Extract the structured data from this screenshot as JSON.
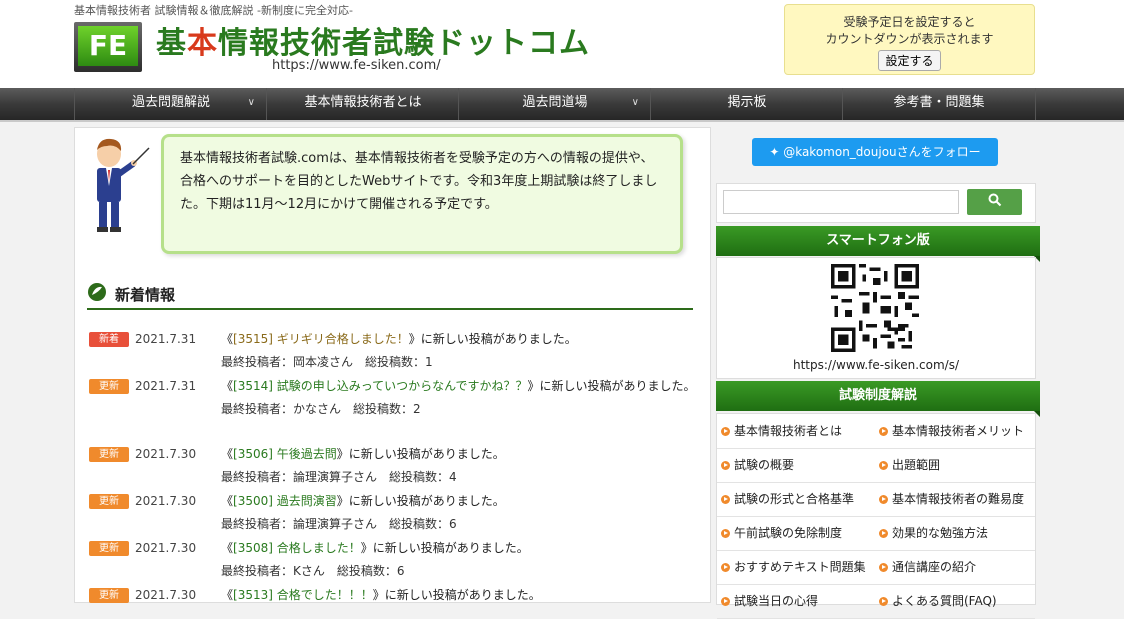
{
  "header": {
    "tagline": "基本情報技術者 試験情報＆徹底解説 -新制度に完全対応-",
    "logo_mark": "FE",
    "title_a": "基",
    "title_b": "本",
    "title_c": "情報技術者試験ドットコム",
    "url": "https://www.fe-siken.com/",
    "countdown_line1": "受験予定日を設定すると",
    "countdown_line2": "カウントダウンが表示されます",
    "countdown_button": "設定する"
  },
  "nav": [
    {
      "label": "過去問題解説",
      "dropdown": true
    },
    {
      "label": "基本情報技術者とは",
      "dropdown": false
    },
    {
      "label": "過去問道場",
      "dropdown": true
    },
    {
      "label": "掲示板",
      "dropdown": false
    },
    {
      "label": "参考書・問題集",
      "dropdown": false
    }
  ],
  "intro": {
    "text": "基本情報技術者試験.comは、基本情報技術者を受験予定の方への情報の提供や、合格へのサポートを目的としたWebサイトです。令和3年度上期試験は終了しました。下期は11月～12月にかけて開催される予定です。"
  },
  "news": {
    "title": "新着情報",
    "items": [
      {
        "badge": "新着",
        "type": "new",
        "date": "2021.7.31",
        "open": "《",
        "link": "[3515] ギリギリ合格しました！",
        "rest": "》に新しい投稿がありました。",
        "sub": "最終投稿者：岡本凌さん　総投稿数：1",
        "color": "brown"
      },
      {
        "badge": "更新",
        "type": "upd",
        "date": "2021.7.31",
        "open": "《",
        "link": "[3514] 試験の申し込みっていつからなんですかね？？",
        "rest": "》に新しい投稿がありました。",
        "sub": "最終投稿者：かなさん　総投稿数：2",
        "color": "green"
      },
      {
        "badge": "更新",
        "type": "upd",
        "date": "2021.7.30",
        "open": "《",
        "link": "[3506] 午後過去問",
        "rest": "》に新しい投稿がありました。",
        "sub": "最終投稿者：論理演算子さん　総投稿数：4",
        "color": "green"
      },
      {
        "badge": "更新",
        "type": "upd",
        "date": "2021.7.30",
        "open": "《",
        "link": "[3500] 過去問演習",
        "rest": "》に新しい投稿がありました。",
        "sub": "最終投稿者：論理演算子さん　総投稿数：6",
        "color": "green"
      },
      {
        "badge": "更新",
        "type": "upd",
        "date": "2021.7.30",
        "open": "《",
        "link": "[3508] 合格しました！",
        "rest": "》に新しい投稿がありました。",
        "sub": "最終投稿者：Kさん　総投稿数：6",
        "color": "green"
      },
      {
        "badge": "更新",
        "type": "upd",
        "date": "2021.7.30",
        "open": "《",
        "link": "[3513] 合格でした！！！",
        "rest": "》に新しい投稿がありました。",
        "sub": "",
        "color": "green"
      }
    ]
  },
  "sidebar": {
    "twitter": "@kakomon_doujouさんをフォロー",
    "smartphone_title": "スマートフォン版",
    "smartphone_url": "https://www.fe-siken.com/s/",
    "system_title": "試験制度解説",
    "links": [
      "基本情報技術者とは",
      "基本情報技術者メリット",
      "試験の概要",
      "出題範囲",
      "試験の形式と合格基準",
      "基本情報技術者の難易度",
      "午前試験の免除制度",
      "効果的な勉強方法",
      "おすすめテキスト問題集",
      "通信講座の紹介",
      "試験当日の心得",
      "よくある質問(FAQ)"
    ]
  },
  "colors": {
    "accent_green": "#2a7a1f",
    "badge_new": "#e8503a",
    "badge_update": "#f08a2c",
    "twitter": "#1d9bf0"
  }
}
